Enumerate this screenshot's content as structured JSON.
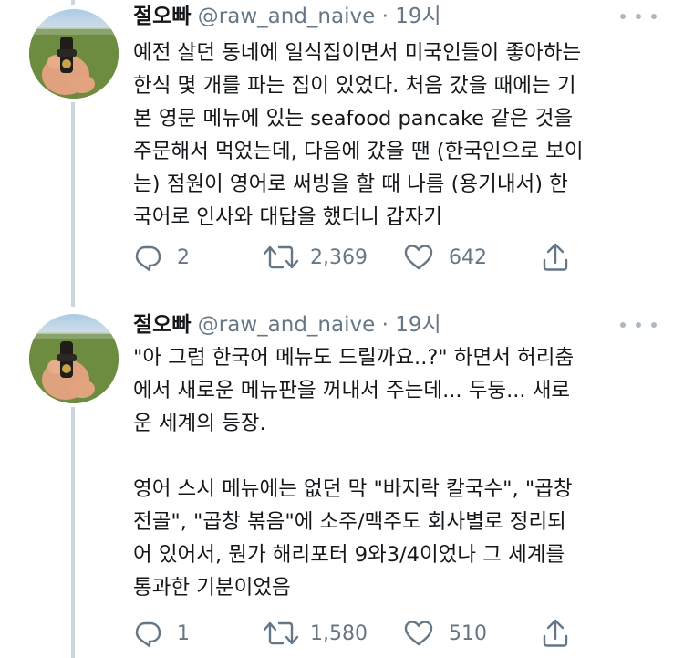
{
  "tweets": [
    {
      "author": {
        "name": "절오빠",
        "handle": "@raw_and_naive",
        "time": "· 19시"
      },
      "text": "예전 살던 동네에 일식집이면서 미국인들이 좋아하는\n한식 몇 개를 파는 집이 있었다. 처음 갔을 때에는 기\n본 영문 메뉴에 있는 seafood pancake 같은 것을\n주문해서 먹었는데, 다음에 갔을 땐 (한국인으로 보이\n는) 점원이 영어로 써빙을 할 때 나름 (용기내서) 한\n국어로 인사와 대답을 했더니 갑자기",
      "replies": "2",
      "retweets": "2,369",
      "likes": "642"
    },
    {
      "author": {
        "name": "절오빠",
        "handle": "@raw_and_naive",
        "time": "· 19시"
      },
      "text": "\"아 그럼 한국어 메뉴도 드릴까요..?\" 하면서 허리춤\n에서 새로운 메뉴판을 꺼내서 주는데... 두둥... 새로\n운 세계의 등장.\n\n영어 스시 메뉴에는 없던 막 \"바지락 칼국수\", \"곱창\n전골\", \"곱창 볶음\"에 소주/맥주도 회사별로 정리되\n어 있어서, 뭔가 해리포터 9와3/4이었나 그 세계를\n통과한 기분이었음",
      "replies": "1",
      "retweets": "1,580",
      "likes": "510"
    }
  ],
  "icons": {
    "reply": "reply-icon",
    "retweet": "retweet-icon",
    "like": "heart-icon",
    "share": "share-icon",
    "more": "more-icon"
  },
  "colors": {
    "text": "#14171a",
    "secondary": "#657786",
    "thread_line": "#ccd6dd",
    "icon": "#657786"
  }
}
